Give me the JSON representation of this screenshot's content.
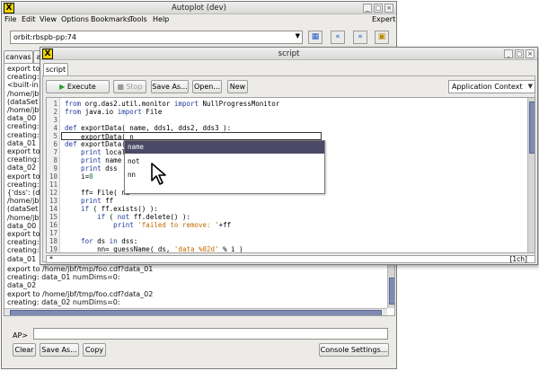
{
  "main_window": {
    "title": "Autoplot (dev)",
    "menus": [
      "File",
      "Edit",
      "View",
      "Options",
      "Bookmarks",
      "Tools",
      "Help"
    ],
    "expert": "Expert",
    "address": "orbit:rbspb-pp:74",
    "tabs": [
      "canvas",
      "a"
    ],
    "log_top": [
      "export to",
      "creating:",
      "<built-in",
      "/home/jbf",
      "(dataSet",
      "/home/jbf",
      "data_00",
      "creating:",
      "creating:",
      "data_01",
      "export to",
      "creating:",
      "data_02",
      "export to",
      "creating:",
      "{'dss': (d",
      "/home/jbf",
      "(dataSet",
      "/home/jbf",
      "data_00",
      "export to",
      "creating:",
      "creating:",
      "data_01"
    ],
    "log_bottom": [
      "export to /home/jbf/tmp/foo.cdf?data_01",
      "creating: data_01 numDims=0:",
      "data_02",
      "export to /home/jbf/tmp/foo.cdf?data_02",
      "creating: data_02 numDims=0:"
    ],
    "prompt_label": "AP>",
    "buttons": {
      "clear": "Clear",
      "save_as": "Save As...",
      "copy": "Copy",
      "console_settings": "Console Settings..."
    }
  },
  "script_window": {
    "title": "script",
    "tab": "script",
    "toolbar": {
      "execute": "Execute",
      "stop": "Stop",
      "save_as": "Save As...",
      "open": "Open...",
      "new": "New",
      "context": "Application Context"
    },
    "line_numbers": [
      "1",
      "2",
      "3",
      "4",
      "5",
      "6",
      "7",
      "8",
      "9",
      "10",
      "11",
      "12",
      "13",
      "14",
      "15",
      "16",
      "17",
      "18",
      "19"
    ],
    "code": {
      "l1_a": "from",
      "l1_b": " org.das2.util.monitor ",
      "l1_c": "import",
      "l1_d": " NullProgressMonitor",
      "l2_a": "from",
      "l2_b": " java.io ",
      "l2_c": "import",
      "l2_d": " File",
      "l4_a": "def",
      "l4_b": " exportData( name, dds1, dds2, dds3 ):",
      "l5": "    exportData( n",
      "l6_a": "def",
      "l6_b": " exportData(",
      "l7_a": "    print",
      "l7_b": " locals",
      "l8_a": "    print",
      "l8_b": " name",
      "l9_a": "    print",
      "l9_b": " dss",
      "l10_a": "    i=",
      "l10_b": "0",
      "l12_a": "    ff= File( na",
      "l13_a": "    print",
      "l13_b": " ff",
      "l14_a": "    if",
      "l14_b": " ( ff.exists() ):",
      "l15_a": "        if",
      "l15_b": " ( ",
      "l15_c": "not",
      "l15_d": " ff.delete() ):",
      "l16_a": "            print",
      "l16_b": " 'failed to remove: '",
      "l16_c": "+ff",
      "l18_a": "    for",
      "l18_b": " ds ",
      "l18_c": "in",
      "l18_d": " dss:",
      "l19_a": "        nn= guessName( ds, ",
      "l19_b": "'data_%02d'",
      "l19_c": " % i )"
    },
    "completion": [
      "name",
      "not",
      "nn"
    ],
    "status": "[1ch]",
    "hscroll_marker": "*"
  }
}
